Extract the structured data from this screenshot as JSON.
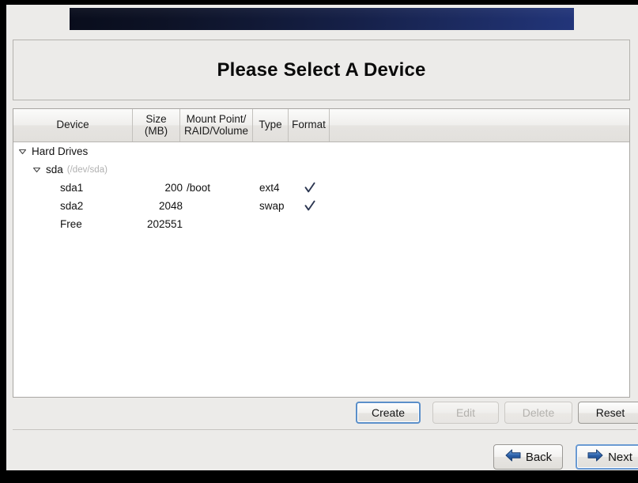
{
  "window": {
    "title": "Please Select A Device",
    "frame_color": "#000000",
    "surface_color": "#ecebe9"
  },
  "banner": {
    "name": "installer-banner",
    "gradient_from": "#090d1c",
    "gradient_to": "#22357a"
  },
  "title_panel": {
    "heading": "Please Select A Device"
  },
  "device_table": {
    "columns": [
      {
        "key": "device",
        "label": "Device",
        "label_line1": "Device",
        "label_line2": ""
      },
      {
        "key": "size",
        "label": "Size (MB)",
        "label_line1": "Size",
        "label_line2": "(MB)"
      },
      {
        "key": "mount",
        "label": "Mount Point/ RAID/Volume",
        "label_line1": "Mount Point/",
        "label_line2": "RAID/Volume"
      },
      {
        "key": "type",
        "label": "Type",
        "label_line1": "Type",
        "label_line2": ""
      },
      {
        "key": "format",
        "label": "Format",
        "label_line1": "Format",
        "label_line2": ""
      }
    ],
    "rows": [
      {
        "device": "Hard Drives",
        "device_sub": "",
        "indent": 0,
        "expander": "expanded",
        "size": "",
        "mount": "",
        "type": "",
        "format": false
      },
      {
        "device": "sda",
        "device_sub": "(/dev/sda)",
        "indent": 1,
        "expander": "expanded",
        "size": "",
        "mount": "",
        "type": "",
        "format": false
      },
      {
        "device": "sda1",
        "device_sub": "",
        "indent": 2,
        "expander": "none",
        "size": "200",
        "mount": "/boot",
        "type": "ext4",
        "format": true
      },
      {
        "device": "sda2",
        "device_sub": "",
        "indent": 2,
        "expander": "none",
        "size": "2048",
        "mount": "",
        "type": "swap",
        "format": true
      },
      {
        "device": "Free",
        "device_sub": "",
        "indent": 2,
        "expander": "none",
        "size": "202551",
        "mount": "",
        "type": "",
        "format": false
      }
    ],
    "checkmark_color": "#2b3550"
  },
  "actions": {
    "create": {
      "label": "Create",
      "enabled": true,
      "focused": true
    },
    "edit": {
      "label": "Edit",
      "enabled": false,
      "focused": false
    },
    "delete": {
      "label": "Delete",
      "enabled": false,
      "focused": false
    },
    "reset": {
      "label": "Reset",
      "enabled": true,
      "focused": false
    }
  },
  "navigation": {
    "back": {
      "label": "Back",
      "icon": "arrow-left-icon",
      "focused": false
    },
    "next": {
      "label": "Next",
      "icon": "arrow-right-icon",
      "focused": true
    },
    "arrow_color": "#2a5fa8"
  }
}
